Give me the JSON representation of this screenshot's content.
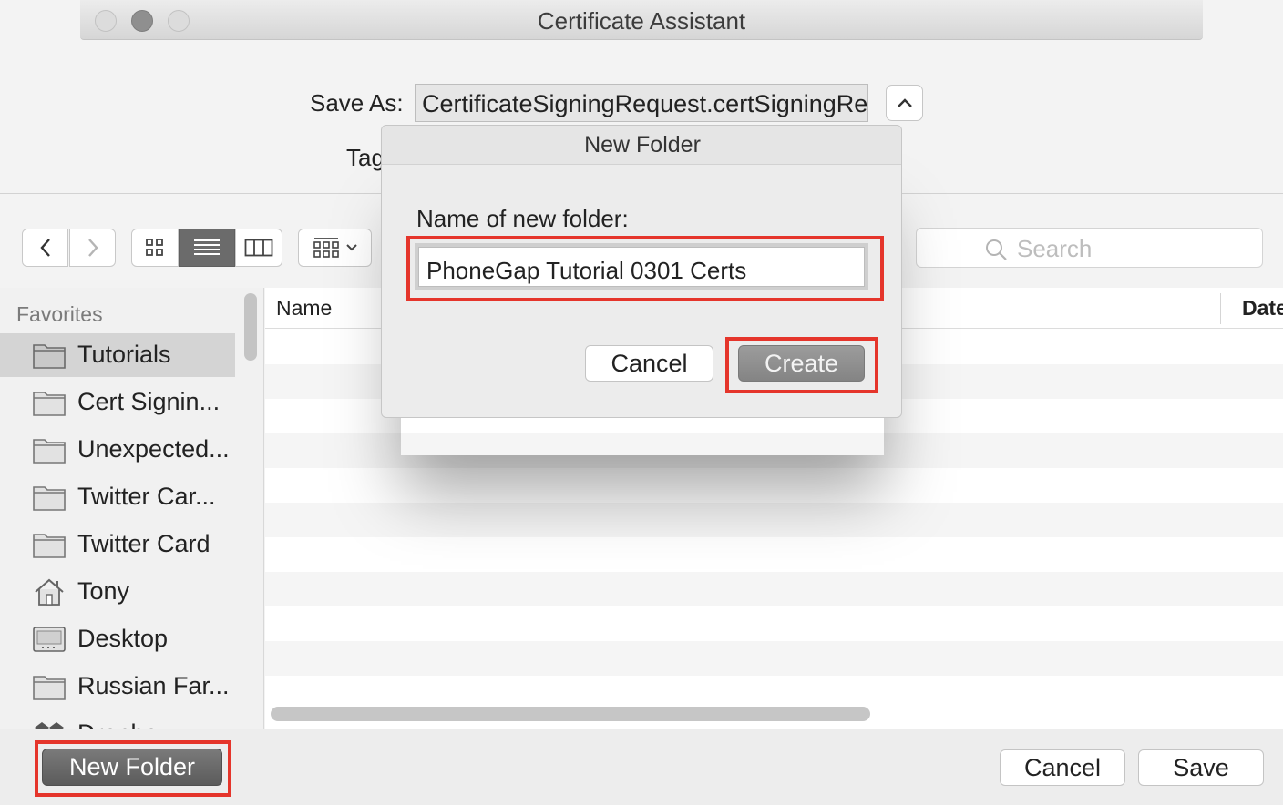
{
  "window": {
    "title": "Certificate Assistant"
  },
  "save_as": {
    "label": "Save As:",
    "value": "CertificateSigningRequest.certSigningRequest",
    "tags_label": "Tags:"
  },
  "search": {
    "placeholder": "Search"
  },
  "sidebar": {
    "heading": "Favorites",
    "items": [
      {
        "label": "Tutorials",
        "icon": "folder-icon",
        "selected": true
      },
      {
        "label": "Cert Signin...",
        "icon": "folder-icon"
      },
      {
        "label": "Unexpected...",
        "icon": "folder-icon"
      },
      {
        "label": "Twitter Car...",
        "icon": "folder-icon"
      },
      {
        "label": "Twitter Card",
        "icon": "folder-icon"
      },
      {
        "label": "Tony",
        "icon": "home-icon"
      },
      {
        "label": "Desktop",
        "icon": "desktop-icon"
      },
      {
        "label": "Russian Far...",
        "icon": "folder-icon"
      },
      {
        "label": "Dropbox",
        "icon": "dropbox-icon"
      }
    ]
  },
  "file_list": {
    "columns": [
      "Name",
      "Date Modified"
    ]
  },
  "new_folder_dialog": {
    "title": "New Folder",
    "prompt": "Name of new folder:",
    "value": "PhoneGap Tutorial 0301 Certs",
    "cancel_label": "Cancel",
    "create_label": "Create"
  },
  "bottom_bar": {
    "new_folder_label": "New Folder",
    "cancel_label": "Cancel",
    "save_label": "Save"
  },
  "colors": {
    "highlight": "#e5352b",
    "sidebar_selected": "#d4d4d4",
    "dark_button": "#5b5b5b"
  }
}
